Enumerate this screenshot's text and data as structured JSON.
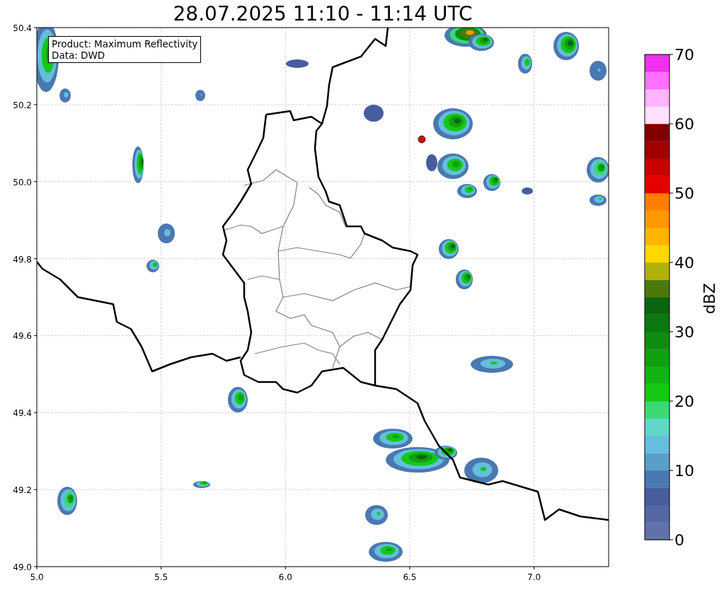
{
  "title": "28.07.2025 11:10 - 11:14 UTC",
  "info_box": [
    "Product: Maximum Reflectivity",
    "Data: DWD"
  ],
  "map": {
    "xticks": [
      "5.0",
      "5.5",
      "6.0",
      "6.5",
      "7.0"
    ],
    "yticks": [
      "50.4",
      "50.2",
      "50.0",
      "49.8",
      "49.6",
      "49.4",
      "49.2",
      "49.0"
    ]
  },
  "colorbar": {
    "label": "dBZ",
    "ticks": [
      "70",
      "60",
      "50",
      "40",
      "30",
      "20",
      "10",
      "0"
    ],
    "bins": [
      {
        "color": "#6272a8"
      },
      {
        "color": "#5468a3"
      },
      {
        "color": "#465e9e"
      },
      {
        "color": "#4a78b0"
      },
      {
        "color": "#5a9ec8"
      },
      {
        "color": "#64bedc"
      },
      {
        "color": "#60d8c8"
      },
      {
        "color": "#3cd874"
      },
      {
        "color": "#14c814"
      },
      {
        "color": "#12b412"
      },
      {
        "color": "#10a010"
      },
      {
        "color": "#0e8c10"
      },
      {
        "color": "#0c7810"
      },
      {
        "color": "#0a6410"
      },
      {
        "color": "#4c7a0a"
      },
      {
        "color": "#b0b00a"
      },
      {
        "color": "#ffd800"
      },
      {
        "color": "#ffb400"
      },
      {
        "color": "#ff9800"
      },
      {
        "color": "#ff7e00"
      },
      {
        "color": "#e60000"
      },
      {
        "color": "#c80000"
      },
      {
        "color": "#a00000"
      },
      {
        "color": "#800000"
      },
      {
        "color": "#ffe0ff"
      },
      {
        "color": "#ffb4ff"
      },
      {
        "color": "#ff70ff"
      },
      {
        "color": "#ee30ee"
      }
    ]
  }
}
